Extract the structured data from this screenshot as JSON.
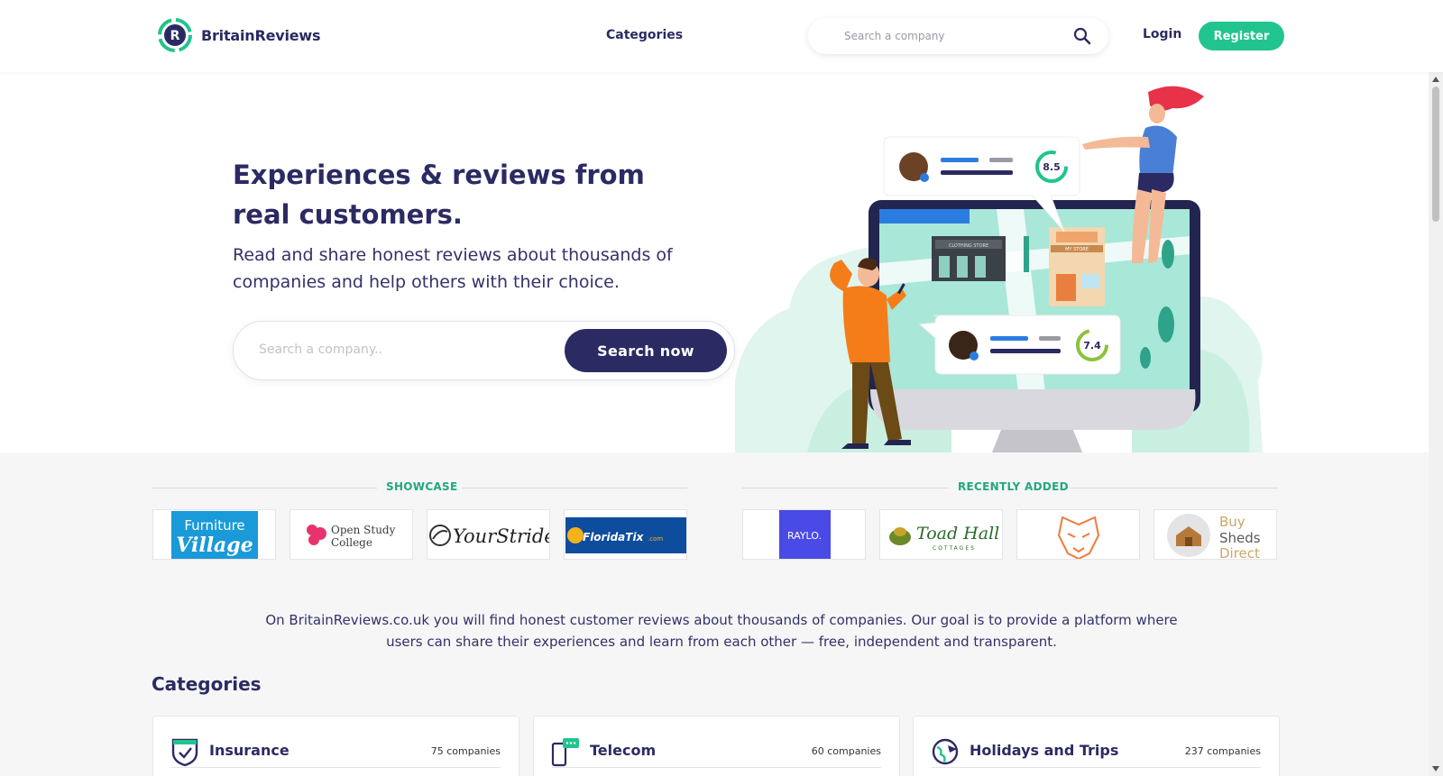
{
  "header": {
    "brand": "BritainReviews",
    "nav_categories": "Categories",
    "search_placeholder": "Search a company",
    "login": "Login",
    "register": "Register"
  },
  "hero": {
    "title": "Experiences & reviews from real customers.",
    "subtitle": "Read and share honest reviews about thousands of companies and help others with their choice.",
    "search_placeholder": "Search a company..",
    "search_button": "Search now",
    "review_scores": [
      "8.5",
      "7.4"
    ],
    "store_signs": [
      "CLOTHING STORE",
      "MY STORE"
    ]
  },
  "showcase": {
    "label": "SHOWCASE",
    "logos": [
      "Furniture Village",
      "Open Study College",
      "YourStride",
      "FloridaTix.com"
    ]
  },
  "recently_added": {
    "label": "RECENTLY ADDED",
    "logos": [
      "RAYLO.",
      "Toad Hall Cottages",
      "tiger-logo",
      "Buy Sheds Direct"
    ]
  },
  "description": "On BritainReviews.co.uk you will find honest customer reviews about thousands of companies. Our goal is to provide a platform where users can share their experiences and learn from each other — free, independent and transparent.",
  "categories": {
    "heading": "Categories",
    "items": [
      {
        "name": "Insurance",
        "count": "75 companies",
        "icon": "shield-check-icon"
      },
      {
        "name": "Telecom",
        "count": "60 companies",
        "icon": "phone-chat-icon"
      },
      {
        "name": "Holidays and Trips",
        "count": "237 companies",
        "icon": "globe-plane-icon"
      }
    ]
  },
  "colors": {
    "navy": "#2c2a63",
    "green": "#21c48e",
    "raylo": "#4a4ae6",
    "background": "#f6f6f7"
  }
}
